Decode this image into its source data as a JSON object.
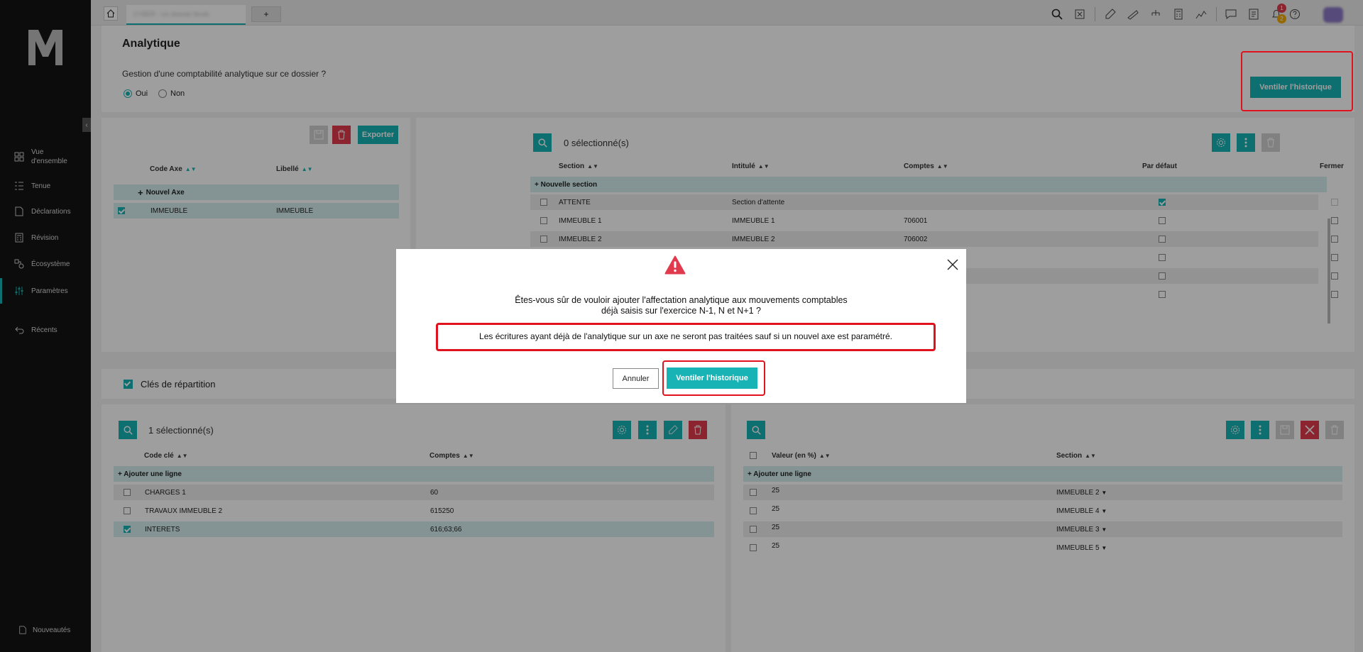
{
  "topbar": {
    "tab_label": "CYBER - Un dossier flouté",
    "add_tab": "+",
    "notif_count": "1",
    "notif_count2": "2"
  },
  "sidebar": {
    "items": [
      {
        "label": "Vue d'ensemble",
        "icon": "grid-icon"
      },
      {
        "label": "Tenue",
        "icon": "list-icon"
      },
      {
        "label": "Déclarations",
        "icon": "document-icon"
      },
      {
        "label": "Révision",
        "icon": "calculator-icon"
      },
      {
        "label": "Écosystème",
        "icon": "ecosystem-icon"
      },
      {
        "label": "Paramètres",
        "icon": "sliders-icon"
      },
      {
        "label": "Récents",
        "icon": "back-icon"
      },
      {
        "label": "Nouveautés",
        "icon": "news-icon"
      }
    ]
  },
  "page": {
    "title": "Analytique",
    "question": "Gestion d'une comptabilité analytique sur ce dossier ?",
    "radio_yes": "Oui",
    "radio_no": "Non",
    "ventiler_button": "Ventiler l'historique"
  },
  "axes_panel": {
    "export_button": "Exporter",
    "col_code": "Code Axe",
    "col_libelle": "Libellé",
    "new_axis": "Nouvel Axe",
    "rows": [
      {
        "code": "IMMEUBLE",
        "libelle": "IMMEUBLE",
        "checked": true
      }
    ]
  },
  "sections_panel": {
    "selected": "0 sélectionné(s)",
    "headers": [
      "Section",
      "Intitulé",
      "Comptes",
      "Par défaut",
      "Fermer"
    ],
    "new_section": "+ Nouvelle section",
    "rows": [
      {
        "section": "ATTENTE",
        "intitule": "Section d'attente",
        "comptes": "",
        "defaut": true
      },
      {
        "section": "IMMEUBLE 1",
        "intitule": "IMMEUBLE 1",
        "comptes": "706001",
        "defaut": false
      },
      {
        "section": "IMMEUBLE 2",
        "intitule": "IMMEUBLE 2",
        "comptes": "706002",
        "defaut": false
      }
    ]
  },
  "cles": {
    "label": "Clés de répartition"
  },
  "keys_panel": {
    "selected": "1 sélectionné(s)",
    "headers": [
      "Code clé",
      "Comptes"
    ],
    "add_line": "+ Ajouter une ligne",
    "rows": [
      {
        "code": "CHARGES 1",
        "comptes": "60",
        "checked": false
      },
      {
        "code": "TRAVAUX IMMEUBLE 2",
        "comptes": "615250",
        "checked": false
      },
      {
        "code": "INTERETS",
        "comptes": "616;63;66",
        "checked": true
      }
    ]
  },
  "values_panel": {
    "headers": [
      "Valeur (en %)",
      "Section"
    ],
    "add_line": "+ Ajouter une ligne",
    "rows": [
      {
        "valeur": "25",
        "section": "IMMEUBLE 2"
      },
      {
        "valeur": "25",
        "section": "IMMEUBLE 4"
      },
      {
        "valeur": "25",
        "section": "IMMEUBLE 3"
      },
      {
        "valeur": "25",
        "section": "IMMEUBLE 5"
      }
    ]
  },
  "modal": {
    "line1": "Êtes-vous sûr de vouloir ajouter l'affectation analytique aux mouvements comptables",
    "line2": "déjà saisis sur l'exercice N-1, N et N+1 ?",
    "warning": "Les écritures ayant déjà de l'analytique sur un axe ne seront pas traitées sauf si un nouvel axe est paramétré.",
    "cancel": "Annuler",
    "confirm": "Ventiler l'historique"
  },
  "colors": {
    "accent": "#18b3b5",
    "danger": "#e23a4d",
    "highlight": "#e0121e"
  }
}
